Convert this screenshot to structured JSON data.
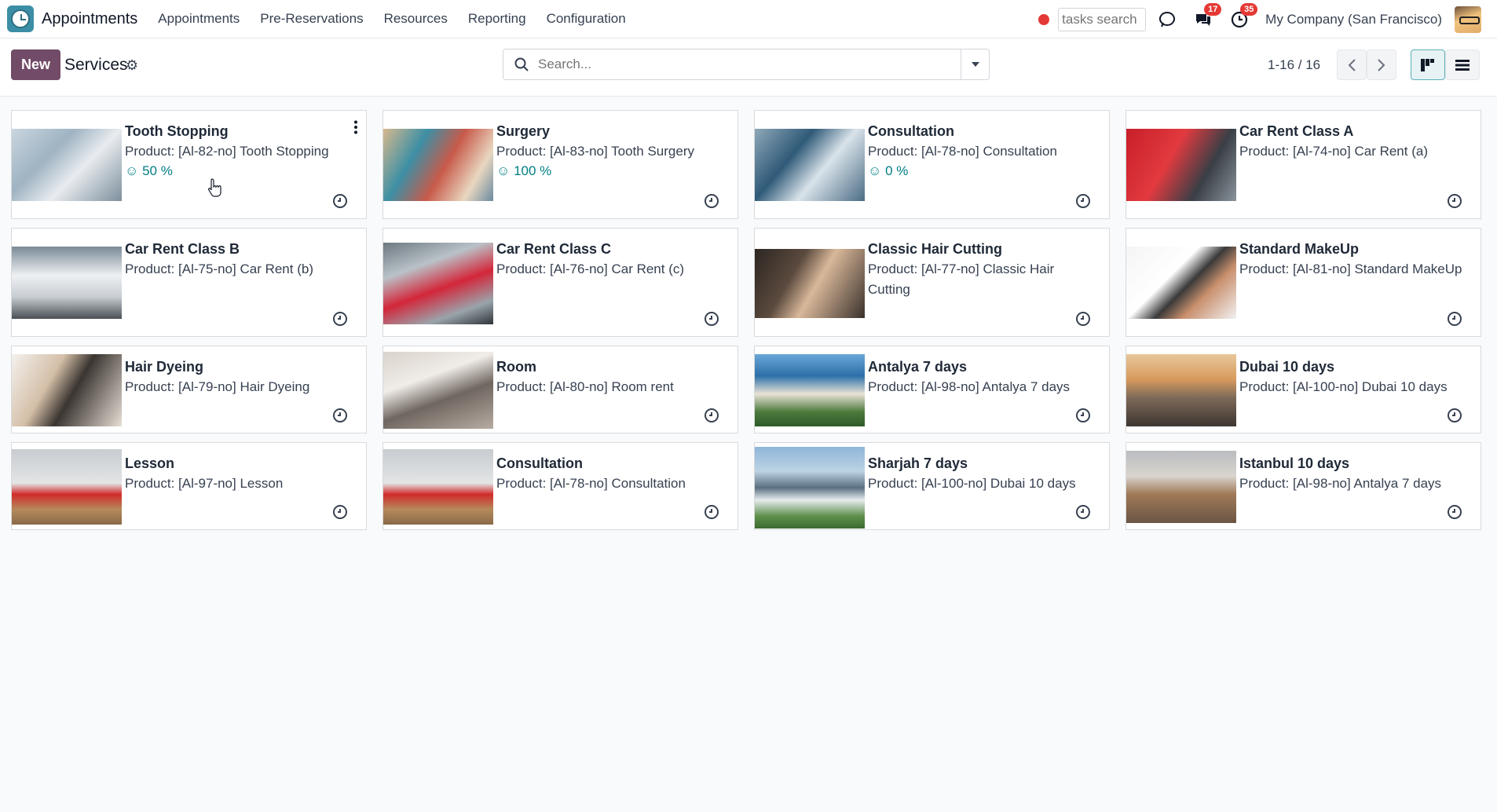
{
  "navbar": {
    "app_name": "Appointments",
    "menu": [
      "Appointments",
      "Pre-Reservations",
      "Resources",
      "Reporting",
      "Configuration"
    ],
    "tasks_search_placeholder": "tasks search",
    "messages_badge": "17",
    "activities_badge": "35",
    "company": "My Company (San Francisco)"
  },
  "control": {
    "new_label": "New",
    "title": "Services",
    "search_placeholder": "Search...",
    "pager": "1-16 / 16"
  },
  "colors": {
    "brand": "#714b67",
    "accent": "#017e84",
    "badge": "#e53935"
  },
  "cards": [
    {
      "name": "Tooth Stopping",
      "product": "Product: [Al-82-no] Tooth Stopping",
      "rating": "50 %",
      "image": "dentist-photo"
    },
    {
      "name": "Surgery",
      "product": "Product: [Al-83-no] Tooth Surgery",
      "rating": "100 %",
      "image": "dental-surgery-photo"
    },
    {
      "name": "Consultation",
      "product": "Product: [Al-78-no] Consultation",
      "rating": "0 %",
      "image": "dental-consultation-photo"
    },
    {
      "name": "Car Rent Class A",
      "product": "Product: [Al-74-no] Car Rent (a)",
      "image": "red-car-photo"
    },
    {
      "name": "Car Rent Class B",
      "product": "Product: [Al-75-no] Car Rent (b)",
      "image": "white-suv-photo"
    },
    {
      "name": "Car Rent Class C",
      "product": "Product: [Al-76-no] Car Rent (c)",
      "image": "parking-cars-photo"
    },
    {
      "name": "Classic Hair Cutting",
      "product": "Product: [Al-77-no] Classic Hair Cutting",
      "image": "haircut-photo"
    },
    {
      "name": "Standard MakeUp",
      "product": "Product: [Al-81-no] Standard MakeUp",
      "image": "makeup-photo"
    },
    {
      "name": "Hair Dyeing",
      "product": "Product: [Al-79-no] Hair Dyeing",
      "image": "hair-dye-photo"
    },
    {
      "name": "Room",
      "product": "Product: [Al-80-no] Room rent",
      "image": "room-photo"
    },
    {
      "name": "Antalya 7 days",
      "product": "Product: [Al-98-no] Antalya 7 days",
      "image": "antalya-photo"
    },
    {
      "name": "Dubai 10 days",
      "product": "Product: [Al-100-no] Dubai 10 days",
      "image": "dubai-photo"
    },
    {
      "name": "Lesson",
      "product": "Product: [Al-97-no] Lesson",
      "image": "lesson-photo"
    },
    {
      "name": "Consultation",
      "product": "Product: [Al-78-no] Consultation",
      "image": "lesson-photo"
    },
    {
      "name": "Sharjah 7 days",
      "product": "Product: [Al-100-no] Dubai 10 days",
      "image": "sharjah-photo"
    },
    {
      "name": "Istanbul 10 days",
      "product": "Product: [Al-98-no] Antalya 7 days",
      "image": "istanbul-photo"
    }
  ]
}
